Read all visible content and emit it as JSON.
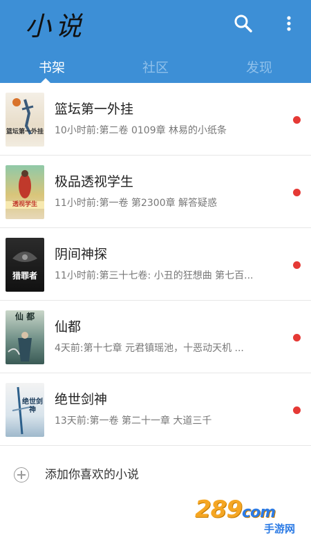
{
  "header": {
    "app_title": "小说",
    "search_icon": "search-icon",
    "more_icon": "more-vertical-icon",
    "background_color": "#3d8fd6"
  },
  "tabs": [
    {
      "label": "书架",
      "active": true
    },
    {
      "label": "社区",
      "active": false
    },
    {
      "label": "发现",
      "active": false
    }
  ],
  "books": [
    {
      "title": "篮坛第一外挂",
      "update": "10小时前:第二卷 0109章 林易的小纸条",
      "cover_text": "篮坛第一外挂",
      "unread": true
    },
    {
      "title": "极品透视学生",
      "update": "11小时前:第一卷 第2300章 解答疑惑",
      "cover_text": "透视学生",
      "unread": true
    },
    {
      "title": "阴间神探",
      "update": "11小时前:第三十七卷: 小丑的狂想曲 第七百...",
      "cover_text": "猎罪者",
      "unread": true
    },
    {
      "title": "仙都",
      "update": "4天前:第十七章 元君镇瑶池，十恶动天机 ...",
      "cover_text": "仙 都",
      "unread": true
    },
    {
      "title": "绝世剑神",
      "update": "13天前:第一卷 第二十一章 大道三千",
      "cover_text": "绝世剑神",
      "unread": true
    }
  ],
  "add_book": {
    "label": "添加你喜欢的小说",
    "icon": "plus-circle-icon"
  },
  "watermark": {
    "brand": "289",
    "suffix": "com",
    "sub": "手游网"
  },
  "colors": {
    "unread_dot": "#e53935",
    "tab_active": "#ffffff",
    "tab_inactive": "#8fc0ea"
  }
}
